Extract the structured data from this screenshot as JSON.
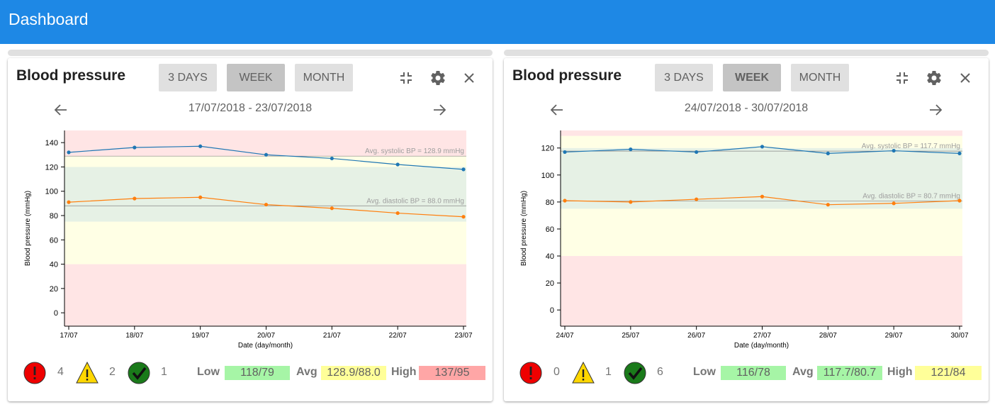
{
  "app": {
    "title": "Dashboard"
  },
  "panels": [
    {
      "title": "Blood pressure",
      "range_buttons": [
        "3 DAYS",
        "WEEK",
        "MONTH"
      ],
      "active_range": "WEEK",
      "date_range": "17/07/2018 - 23/07/2018",
      "counts": {
        "alert": "4",
        "warning": "2",
        "ok": "1"
      },
      "low_label": "Low",
      "low_value": "118/79",
      "avg_label": "Avg",
      "avg_value": "128.9/88.0",
      "high_label": "High",
      "high_value": "137/95",
      "colors": {
        "low_box": "#a6f5a6",
        "avg_box": "#ffff99",
        "high_box": "#ffa6a6"
      },
      "chart_data": {
        "type": "line",
        "categories": [
          "17/07",
          "18/07",
          "19/07",
          "20/07",
          "21/07",
          "22/07",
          "23/07"
        ],
        "series": [
          {
            "values": [
              132,
              136,
              137,
              130,
              127,
              122,
              118
            ],
            "color": "#1f77b4"
          },
          {
            "values": [
              91,
              94,
              95,
              89,
              86,
              82,
              79
            ],
            "color": "#ff7f0e"
          }
        ],
        "avg_lines": [
          {
            "label": "Avg. systolic BP = 128.9 mmHg",
            "value": 128.9
          },
          {
            "label": "Avg. diastolic BP = 88.0 mmHg",
            "value": 88.0
          }
        ],
        "bands": [
          {
            "from": -11,
            "to": 40,
            "color": "#ffe5e5"
          },
          {
            "from": 40,
            "to": 75,
            "color": "#ffffe5"
          },
          {
            "from": 75,
            "to": 120,
            "color": "#e6f1e5"
          },
          {
            "from": 120,
            "to": 129,
            "color": "#ffffe5"
          },
          {
            "from": 129,
            "to": 150,
            "color": "#ffe5e5"
          }
        ],
        "ylim": [
          -11,
          150
        ],
        "yticks": [
          0,
          20,
          40,
          60,
          80,
          100,
          120,
          140
        ],
        "xlabel": "Date (day/month)",
        "ylabel": "Blood pressure (mmHg)"
      }
    },
    {
      "title": "Blood pressure",
      "range_buttons": [
        "3 DAYS",
        "WEEK",
        "MONTH"
      ],
      "active_range": "WEEK",
      "date_range": "24/07/2018 - 30/07/2018",
      "counts": {
        "alert": "0",
        "warning": "1",
        "ok": "6"
      },
      "low_label": "Low",
      "low_value": "116/78",
      "avg_label": "Avg",
      "avg_value": "117.7/80.7",
      "high_label": "High",
      "high_value": "121/84",
      "colors": {
        "low_box": "#a6f5a6",
        "avg_box": "#a6f5a6",
        "high_box": "#ffff99"
      },
      "chart_data": {
        "type": "line",
        "categories": [
          "24/07",
          "25/07",
          "26/07",
          "27/07",
          "28/07",
          "29/07",
          "30/07"
        ],
        "series": [
          {
            "values": [
              117,
              119,
              117,
              121,
              116,
              118,
              116
            ],
            "color": "#1f77b4"
          },
          {
            "values": [
              81,
              80,
              82,
              84,
              78,
              79,
              81
            ],
            "color": "#ff7f0e"
          }
        ],
        "avg_lines": [
          {
            "label": "Avg. systolic BP = 117.7 mmHg",
            "value": 117.7
          },
          {
            "label": "Avg. diastolic BP = 80.7 mmHg",
            "value": 80.7
          }
        ],
        "bands": [
          {
            "from": -12,
            "to": 40,
            "color": "#ffe5e5"
          },
          {
            "from": 40,
            "to": 75,
            "color": "#ffffe5"
          },
          {
            "from": 75,
            "to": 120,
            "color": "#e6f1e5"
          },
          {
            "from": 120,
            "to": 129,
            "color": "#ffffe5"
          },
          {
            "from": 129,
            "to": 133,
            "color": "#ffe5e5"
          }
        ],
        "ylim": [
          -12,
          133
        ],
        "yticks": [
          0,
          20,
          40,
          60,
          80,
          100,
          120
        ],
        "xlabel": "Date (day/month)",
        "ylabel": "Blood pressure (mmHg)"
      }
    }
  ]
}
